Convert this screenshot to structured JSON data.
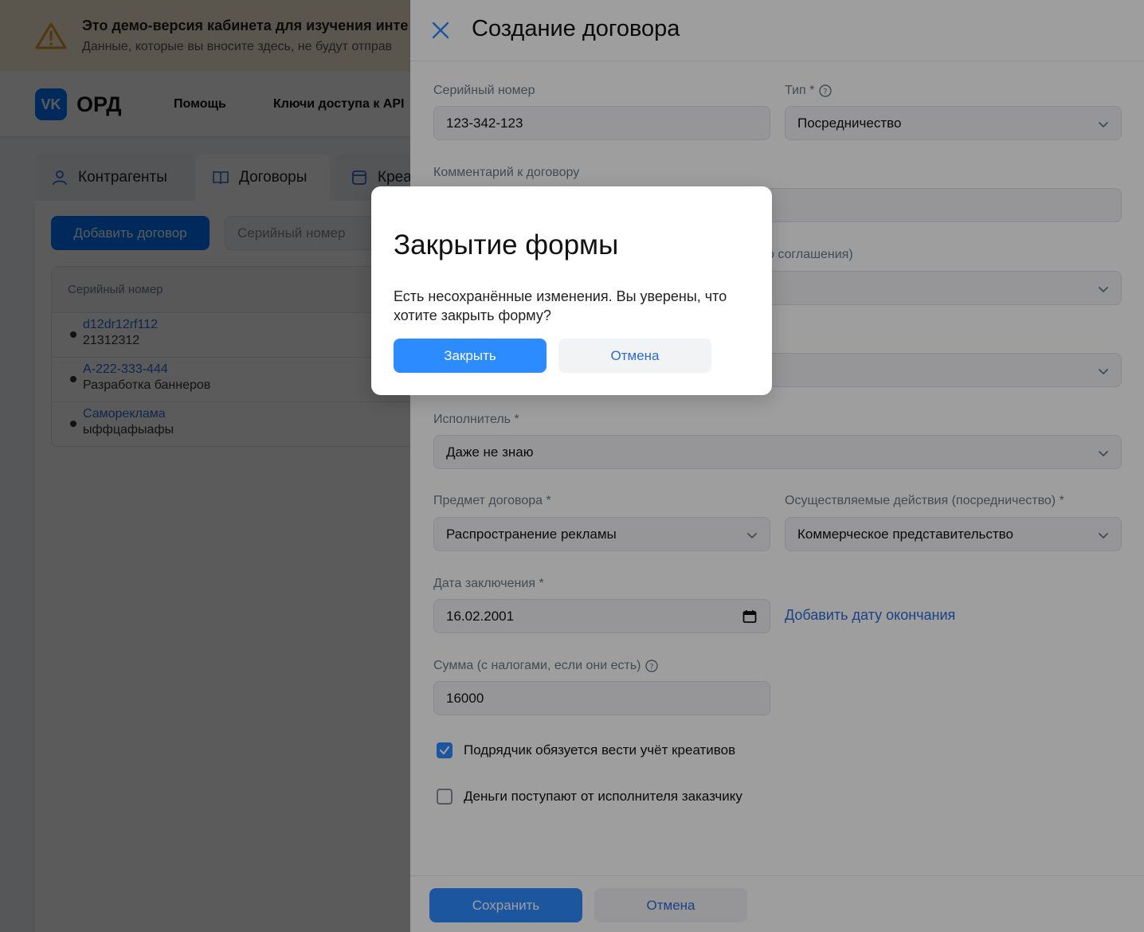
{
  "banner": {
    "title": "Это демо-версия кабинета для изучения инте",
    "subtitle": "Данные, которые вы вносите здесь, не будут отправ"
  },
  "header": {
    "logo_mark": "VK",
    "logo_text": "ОРД",
    "nav": [
      "Помощь",
      "Ключи доступа к API"
    ]
  },
  "tabs": [
    {
      "label": "Контрагенты"
    },
    {
      "label": "Договоры"
    },
    {
      "label": "Креа"
    }
  ],
  "list": {
    "add_button": "Добавить договор",
    "search_placeholder": "Серийный номер",
    "column": "Серийный номер",
    "rows": [
      {
        "title": "d12dr12rf112",
        "subtitle": "21312312"
      },
      {
        "title": "А-222-333-444",
        "subtitle": "Разработка баннеров"
      },
      {
        "title": "Самореклама",
        "subtitle": "ыффцафыафы"
      }
    ]
  },
  "panel": {
    "title": "Создание договора",
    "serial_label": "Серийный номер",
    "serial_value": "123-342-123",
    "type_label": "Тип *",
    "type_value": "Посредничество",
    "comment_label": "Комментарий к договору",
    "agreement_label_fragment": "о соглашения)",
    "executor_label": "Исполнитель *",
    "executor_value": "Даже не знаю",
    "subject_label": "Предмет договора *",
    "subject_value": "Распространение рекламы",
    "actions_label": "Осуществляемые действия (посредничество) *",
    "actions_value": "Коммерческое представительство",
    "date_label": "Дата заключения *",
    "date_value": "16.02.2001",
    "add_end_date": "Добавить дату окончания",
    "sum_label": "Сумма (с налогами, если они есть)",
    "sum_value": "16000",
    "checkbox1": {
      "label": "Подрядчик обязуется вести учёт креативов",
      "checked": true
    },
    "checkbox2": {
      "label": "Деньги поступают от исполнителя заказчику",
      "checked": false
    },
    "save_button": "Сохранить",
    "cancel_button": "Отмена"
  },
  "modal": {
    "title": "Закрытие формы",
    "text": "Есть несохранённые изменения. Вы уверены, что хотите закрыть форму?",
    "close_button": "Закрыть",
    "cancel_button": "Отмена"
  },
  "colors": {
    "accent": "#2c8bff",
    "link": "#2c6bd6",
    "vk_blue": "#0077ff",
    "banner_bg": "#fff1d6",
    "warning": "#e09a2a"
  }
}
